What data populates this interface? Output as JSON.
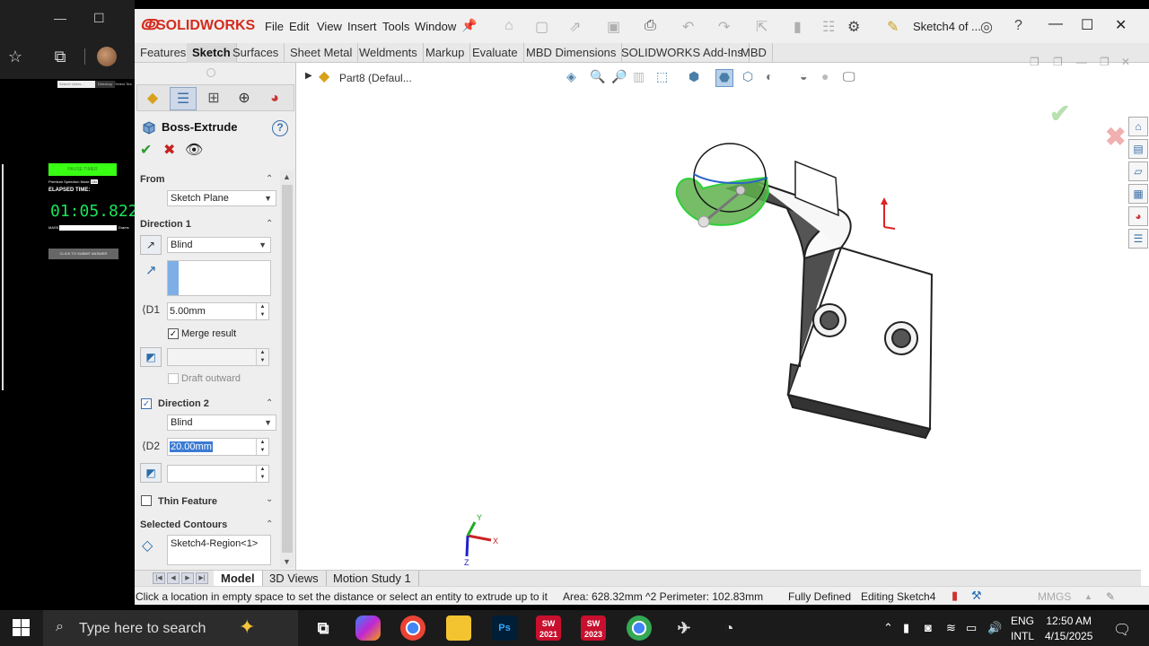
{
  "browser": {
    "search_placeholder": "Search Users...",
    "directory_label": "Directory",
    "select_label": "Select Tea",
    "green_bar_text": "PAUSE TIMER",
    "mode_label": "Premium Speedrun Mode",
    "mode_value": "ON",
    "elapsed_label": "ELAPSED TIME:",
    "timer": "01:05.822",
    "mass_label": "MASS",
    "mass_unit": "Grams",
    "submit_label": "CLICK TO SUBMIT ANSWER"
  },
  "app": {
    "logo": "SOLIDWORKS",
    "menu": [
      "File",
      "Edit",
      "View",
      "Insert",
      "Tools",
      "Window"
    ],
    "doc_title": "Sketch4 of ...",
    "command_tabs": [
      "Features",
      "Sketch",
      "Surfaces",
      "Sheet Metal",
      "Weldments",
      "Markup",
      "Evaluate",
      "MBD Dimensions",
      "SOLIDWORKS Add-Ins",
      "MBD"
    ],
    "active_command_tab": "Sketch"
  },
  "property_manager": {
    "title": "Boss-Extrude",
    "from": {
      "label": "From",
      "value": "Sketch Plane"
    },
    "direction1": {
      "label": "Direction 1",
      "end_condition": "Blind",
      "depth": "5.00mm",
      "merge_result": "Merge result",
      "merge_checked": true,
      "draft_outward": "Draft outward"
    },
    "direction2": {
      "label": "Direction 2",
      "checked": true,
      "end_condition": "Blind",
      "depth": "20.00mm"
    },
    "thin_feature": {
      "label": "Thin Feature",
      "checked": false
    },
    "selected_contours": {
      "label": "Selected Contours",
      "item": "Sketch4-Region<1>"
    }
  },
  "graphics": {
    "tree_item": "Part8  (Defaul..."
  },
  "bottom_tabs": [
    "Model",
    "3D Views",
    "Motion Study 1"
  ],
  "status": {
    "message": "Click a location in empty space to set the distance or select an entity to extrude up to it",
    "area": "Area: 628.32mm ^2 Perimeter: 102.83mm",
    "defined": "Fully Defined",
    "editing": "Editing Sketch4",
    "units": "MMGS"
  },
  "taskbar": {
    "search_placeholder": "Type here to search",
    "apps": [
      "Task View",
      "Copilot",
      "Chrome",
      "File Explorer",
      "Photoshop",
      "SW 2021",
      "SW 2023",
      "Chrome",
      "App",
      "App"
    ],
    "sw2021": "2021",
    "sw2023": "2023",
    "lang1": "ENG",
    "lang2": "INTL",
    "time": "12:50 AM",
    "date": "4/15/2025"
  }
}
